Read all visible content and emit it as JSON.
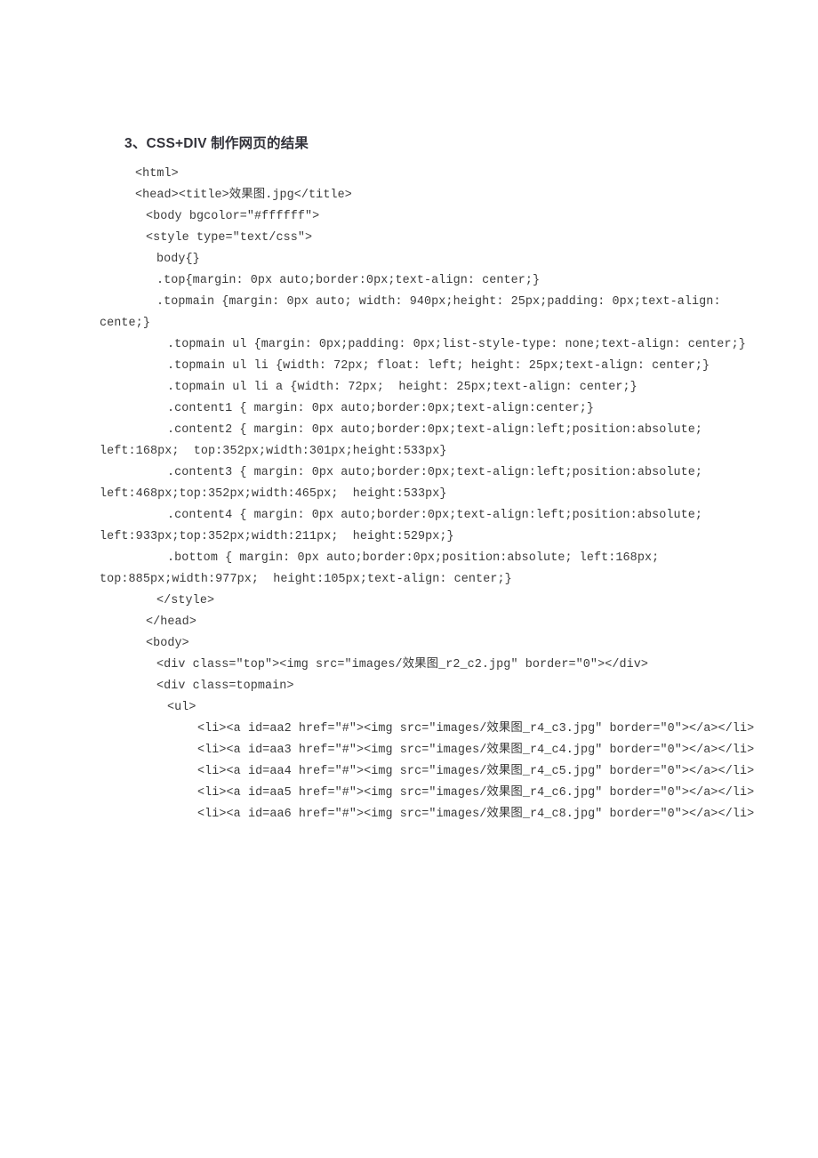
{
  "document": {
    "heading": "3、CSS+DIV 制作网页的结果",
    "text_color": "#3a3a3a",
    "background_color": "#ffffff",
    "code_lines": [
      {
        "indent": 1,
        "text": "<html>"
      },
      {
        "indent": 1,
        "text": "<head><title>效果图.jpg</title>"
      },
      {
        "indent": 2,
        "text": "<body bgcolor=″#ffffff″>"
      },
      {
        "indent": 2,
        "text": "<style type=″text/css″>"
      },
      {
        "indent": 3,
        "text": "body{}"
      },
      {
        "indent": 3,
        "text": ".top{margin: 0px auto;border:0px;text-align: center;}"
      },
      {
        "indent": 3,
        "text": ".topmain {margin: 0px auto; width: 940px;height: 25px;padding: 0px;text-align: cente;}"
      },
      {
        "indent": 4,
        "text": ".topmain ul {margin: 0px;padding: 0px;list-style-type: none;text-align: center;}"
      },
      {
        "indent": 4,
        "text": ".topmain ul li {width: 72px; float: left; height: 25px;text-align: center;}"
      },
      {
        "indent": 4,
        "text": ".topmain ul li a {width: 72px;  height: 25px;text-align: center;}"
      },
      {
        "indent": 4,
        "text": ".content1 { margin: 0px auto;border:0px;text-align:center;}"
      },
      {
        "indent": 4,
        "text": ".content2 { margin: 0px auto;border:0px;text-align:left;position:absolute; left:168px;  top:352px;width:301px;height:533px}"
      },
      {
        "indent": 4,
        "text": ".content3 { margin: 0px auto;border:0px;text-align:left;position:absolute; left:468px;top:352px;width:465px;  height:533px}"
      },
      {
        "indent": 4,
        "text": ".content4 { margin: 0px auto;border:0px;text-align:left;position:absolute; left:933px;top:352px;width:211px;  height:529px;}"
      },
      {
        "indent": 4,
        "text": ".bottom { margin: 0px auto;border:0px;position:absolute; left:168px; top:885px;width:977px;  height:105px;text-align: center;}"
      },
      {
        "indent": 3,
        "text": "</style>"
      },
      {
        "indent": 2,
        "text": "</head>"
      },
      {
        "indent": 2,
        "text": "<body>"
      },
      {
        "indent": 3,
        "text": "<div class=″top″><img src=″images/效果图_r2_c2.jpg″ border=″0″></div>"
      },
      {
        "indent": 3,
        "text": "<div class=topmain>"
      },
      {
        "indent": 4,
        "text": "<ul>"
      },
      {
        "indent": 5,
        "text": "<li><a id=aa2 href=″#″><img src=″images/效果图_r4_c3.jpg″ border=″0″></a></li>"
      },
      {
        "indent": 5,
        "text": "<li><a id=aa3 href=″#″><img src=″images/效果图_r4_c4.jpg″ border=″0″></a></li>"
      },
      {
        "indent": 5,
        "text": "<li><a id=aa4 href=″#″><img src=″images/效果图_r4_c5.jpg″ border=″0″></a></li>"
      },
      {
        "indent": 5,
        "text": "<li><a id=aa5 href=″#″><img src=″images/效果图_r4_c6.jpg″ border=″0″></a></li>"
      },
      {
        "indent": 5,
        "text": "<li><a id=aa6 href=″#″><img src=″images/效果图_r4_c8.jpg″ border=″0″></a></li>"
      }
    ]
  }
}
